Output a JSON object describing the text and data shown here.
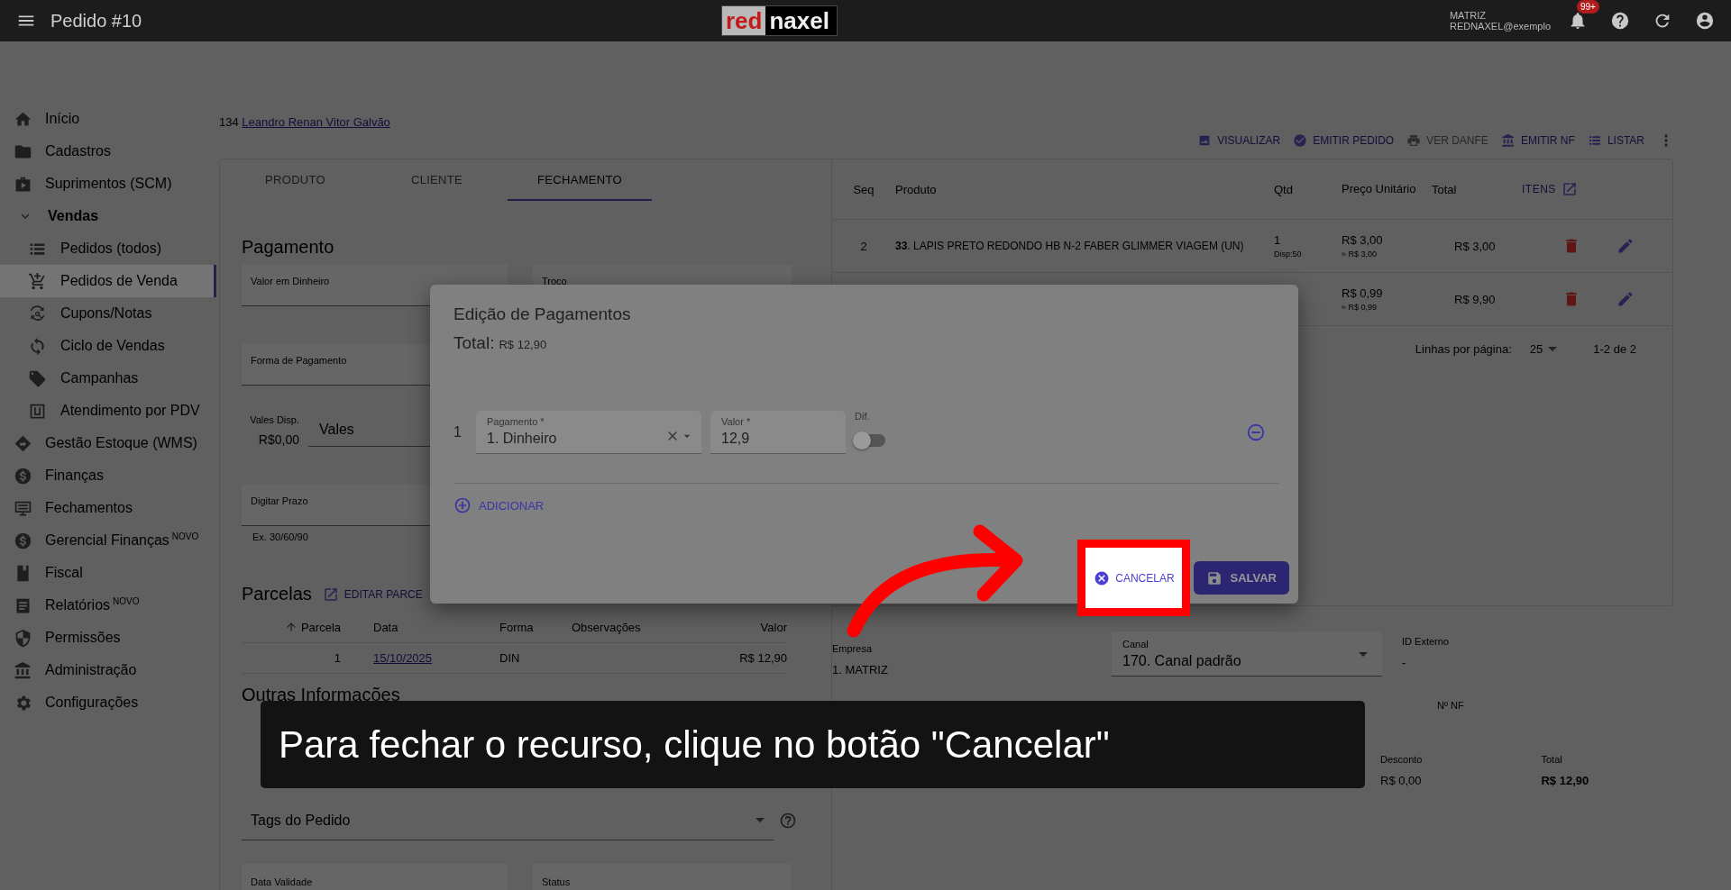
{
  "topbar": {
    "title": "Pedido #10",
    "logo_left": "red",
    "logo_right": "naxel",
    "company": "MATRIZ",
    "user": "REDNAXEL@exemplo",
    "notifications": "99+"
  },
  "sidebar": {
    "items": [
      {
        "label": "Início",
        "selected": false
      },
      {
        "label": "Cadastros",
        "selected": false
      },
      {
        "label": "Suprimentos (SCM)",
        "selected": false
      },
      {
        "label": "Vendas",
        "selected": false,
        "expanded": true,
        "children": [
          {
            "label": "Pedidos (todos)",
            "selected": false
          },
          {
            "label": "Pedidos de Venda",
            "selected": true
          },
          {
            "label": "Cupons/Notas",
            "selected": false
          },
          {
            "label": "Ciclo de Vendas",
            "selected": false
          },
          {
            "label": "Campanhas",
            "selected": false
          },
          {
            "label": "Atendimento por PDV",
            "selected": false
          }
        ]
      },
      {
        "label": "Gestão Estoque (WMS)",
        "selected": false
      },
      {
        "label": "Finanças",
        "selected": false
      },
      {
        "label": "Fechamentos",
        "selected": false
      },
      {
        "label": "Gerencial Finanças",
        "badge": "NOVO",
        "selected": false
      },
      {
        "label": "Fiscal",
        "selected": false
      },
      {
        "label": "Relatórios",
        "badge": "NOVO",
        "selected": false
      },
      {
        "label": "Permissões",
        "selected": false
      },
      {
        "label": "Administração",
        "selected": false
      },
      {
        "label": "Configurações",
        "selected": false
      }
    ]
  },
  "customer": {
    "code": "134",
    "name": "Leandro Renan Vitor Galvão"
  },
  "actions": [
    {
      "label": "VISUALIZAR",
      "disabled": false
    },
    {
      "label": "EMITIR PEDIDO",
      "disabled": false
    },
    {
      "label": "VER DANFE",
      "disabled": true
    },
    {
      "label": "EMITIR NF",
      "disabled": false
    },
    {
      "label": "LISTAR",
      "disabled": false
    }
  ],
  "tabs": [
    {
      "label": "PRODUTO",
      "selected": false
    },
    {
      "label": "CLIENTE",
      "selected": false
    },
    {
      "label": "FECHAMENTO",
      "selected": true
    }
  ],
  "payment": {
    "heading": "Pagamento",
    "cash_label": "Valor em Dinheiro",
    "change_label": "Troco",
    "method_label": "Forma de Pagamento",
    "vouchers_label": "Vales Disp.",
    "vouchers_value": "R$0,00",
    "vouchers_select": "Vales",
    "term_label": "Digitar Prazo",
    "term_hint": "Ex. 30/60/90"
  },
  "installments": {
    "heading": "Parcelas",
    "edit_label": "EDITAR PARCE",
    "columns": [
      "Parcela",
      "Data",
      "Forma",
      "Observações",
      "Valor"
    ],
    "rows": [
      {
        "number": "1",
        "date": "15/10/2025",
        "method": "DIN",
        "notes": "",
        "value": "R$ 12,90"
      }
    ]
  },
  "other": {
    "heading": "Outras Informações",
    "tags_label": "Tags do Pedido",
    "validity_label": "Data Validade",
    "status_label": "Status"
  },
  "items_table": {
    "columns": [
      "Seq",
      "Produto",
      "Qtd",
      "Preço Unitário",
      "Total"
    ],
    "items_link": "ITENS",
    "rows": [
      {
        "seq": "2",
        "product": "**33**. LAPIS PRETO REDONDO HB N-2 FABER GLIMMER VIAGEM (UN)",
        "qty": "1",
        "stock": "Disp:50",
        "price": "R$ 3,00",
        "price_approx": "≈ R$ 3,00",
        "total": "R$ 3,00"
      },
      {
        "seq": "",
        "product": "",
        "qty": "",
        "stock": "",
        "price": "R$ 0,99",
        "price_approx": "≈ R$ 0,99",
        "total": "R$ 9,90"
      }
    ],
    "rows_per_page_label": "Linhas por página:",
    "rows_per_page": "25",
    "range": "1-2 de 2"
  },
  "summary": {
    "company_label": "Empresa",
    "company": "1. MATRIZ",
    "channel_label": "Canal",
    "channel": "170. Canal padrão",
    "external_id_label": "ID Externo",
    "external_id": "-",
    "nf_label": "Nº NF",
    "discount_label": "Desconto",
    "discount": "R$ 0,00",
    "total_label": "Total",
    "total": "R$ 12,90"
  },
  "dialog": {
    "title": "Edição de Pagamentos",
    "total_label": "Total:",
    "total": "R$ 12,90",
    "rows": [
      {
        "index": "1",
        "payment_label": "Pagamento *",
        "payment": "1. Dinheiro",
        "value_label": "Valor *",
        "value": "12,9",
        "dif_label": "Dif.",
        "dif_on": false
      }
    ],
    "add_label": "ADICIONAR",
    "cancel_label": "CANCELAR",
    "save_label": "SALVAR"
  },
  "tutorial": {
    "caption": "Para fechar o recurso, clique no botão \"Cancelar\""
  }
}
